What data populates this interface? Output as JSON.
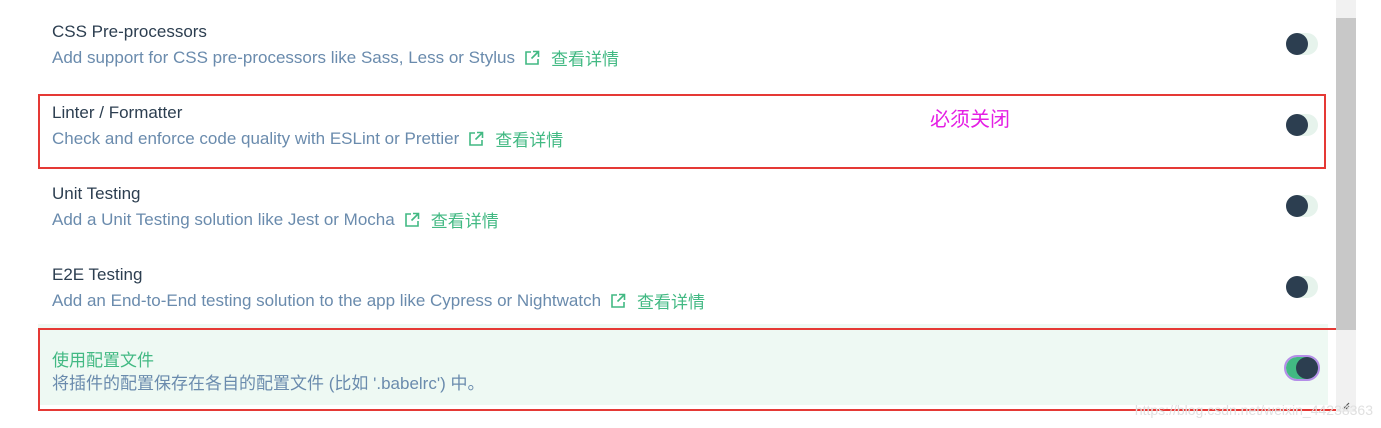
{
  "features": [
    {
      "title": "CSS Pre-processors",
      "description": "Add support for CSS pre-processors like Sass, Less or Stylus",
      "link_label": "查看详情",
      "enabled": false
    },
    {
      "title": "Linter / Formatter",
      "description": "Check and enforce code quality with ESLint or Prettier",
      "link_label": "查看详情",
      "enabled": false
    },
    {
      "title": "Unit Testing",
      "description": "Add a Unit Testing solution like Jest or Mocha",
      "link_label": "查看详情",
      "enabled": false
    },
    {
      "title": "E2E Testing",
      "description": "Add an End-to-End testing solution to the app like Cypress or Nightwatch",
      "link_label": "查看详情",
      "enabled": false
    },
    {
      "title": "使用配置文件",
      "description": "将插件的配置保存在各自的配置文件 (比如 '.babelrc') 中。",
      "enabled": true
    }
  ],
  "annotation": "必须关闭",
  "watermark": "https://blog.csdn.net/weixin_44238363",
  "colors": {
    "accent": "#42b983",
    "highlight_border": "#e53935",
    "annotation": "#e41fe4",
    "toggle_knob": "#2c3e50"
  },
  "icons": {
    "external_link": "external-link-icon",
    "resize": "resize-handle-icon"
  }
}
